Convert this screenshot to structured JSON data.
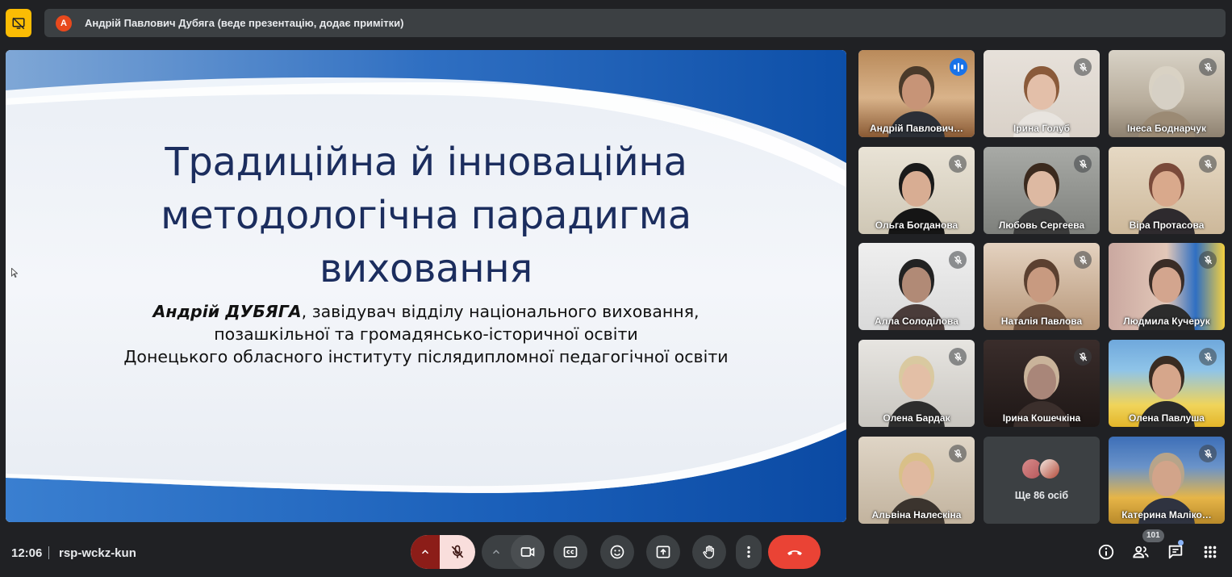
{
  "banner": {
    "avatar_letter": "A",
    "text": "Андрій Павлович Дубяга (веде презентацію, додає примітки)"
  },
  "slide": {
    "title_lines": [
      "Традиційна й інноваційна",
      "методологічна парадигма",
      "виховання"
    ],
    "author_name": "Андрій ДУБЯГА",
    "subtitle_line1_rest": ", завідувач відділу національного виховання,",
    "subtitle_line2": "позашкільної та громадянсько-історичної освіти",
    "subtitle_line3": "Донецького обласного інституту післядипломної педагогічної освіти"
  },
  "participants": [
    {
      "name": "Андрій Павлович…",
      "speaking": true
    },
    {
      "name": "Ірина Голуб",
      "speaking": false
    },
    {
      "name": "Інеса Боднарчук",
      "speaking": false
    },
    {
      "name": "Ольга Богданова",
      "speaking": false
    },
    {
      "name": "Любовь Сергеева",
      "speaking": false
    },
    {
      "name": "Віра Протасова",
      "speaking": false
    },
    {
      "name": "Алла Солоділова",
      "speaking": false
    },
    {
      "name": "Наталія Павлова",
      "speaking": false
    },
    {
      "name": "Людмила Кучерук",
      "speaking": false
    },
    {
      "name": "Олена Бардак",
      "speaking": false
    },
    {
      "name": "Ірина Кошечкіна",
      "speaking": false
    },
    {
      "name": "Олена Павлуша",
      "speaking": false
    },
    {
      "name": "Альвіна Налескіна",
      "speaking": false
    },
    {
      "name": "Катерина Маліко…",
      "speaking": false
    }
  ],
  "more_tile": {
    "label": "Ще 86 осіб"
  },
  "bottom": {
    "time": "12:06",
    "meeting_code": "rsp-wckz-kun",
    "participant_count": "101"
  },
  "colors": {
    "accent_blue": "#1a73e8",
    "leave_red": "#ea4335",
    "mic_off_bg": "#f9dedc",
    "mic_caret_bg": "#8c1d18",
    "present_yellow": "#fbbc04",
    "slide_title": "#1b2d5e"
  },
  "icons": {
    "present": "present-off-icon",
    "mic": "mic-off-icon",
    "camera": "videocam-icon",
    "captions": "closed-captions-icon",
    "emoji": "emoji-icon",
    "share": "present-screen-icon",
    "hand": "raise-hand-icon",
    "more": "more-vert-icon",
    "leave": "call-end-icon",
    "info": "info-icon",
    "people": "people-icon",
    "chat": "chat-icon",
    "activities": "apps-icon"
  }
}
